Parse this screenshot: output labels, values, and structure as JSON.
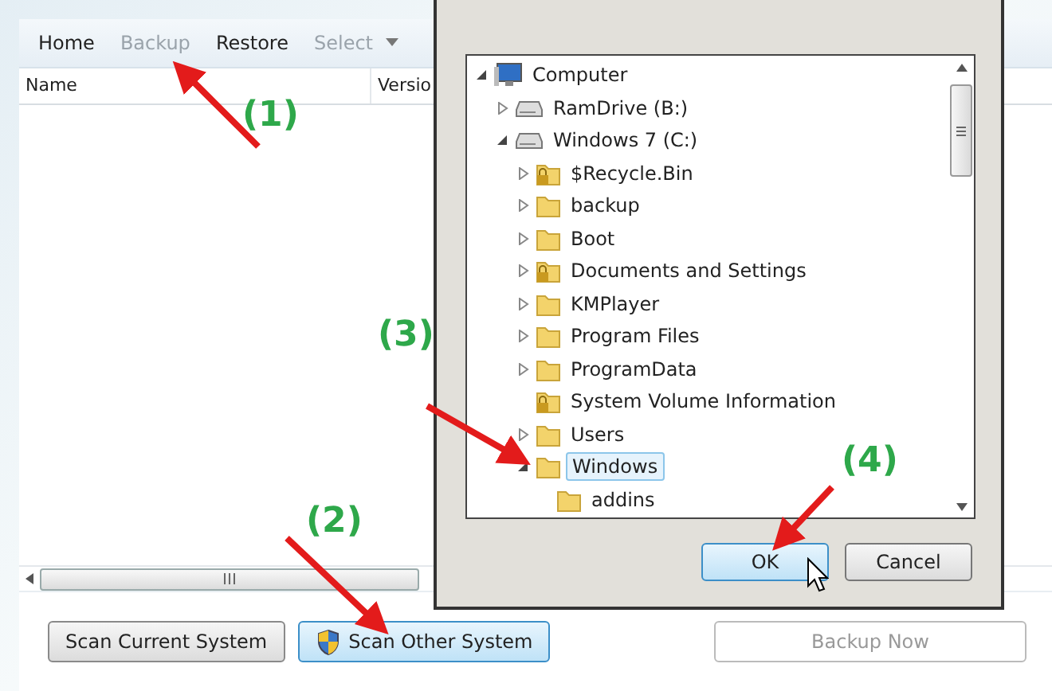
{
  "toolbar": [
    {
      "label": "Home",
      "disabled": false
    },
    {
      "label": "Backup",
      "disabled": true
    },
    {
      "label": "Restore",
      "disabled": false
    },
    {
      "label": "Select",
      "disabled": true,
      "dropdown": true
    }
  ],
  "table": {
    "columns": [
      "Name",
      "Versio"
    ]
  },
  "bottom_buttons": [
    {
      "label": "Scan Current System",
      "focused": false,
      "disabled": false,
      "shield": false
    },
    {
      "label": "Scan Other System",
      "focused": true,
      "disabled": false,
      "shield": true
    },
    {
      "label": "Backup Now",
      "focused": false,
      "disabled": true,
      "shield": false
    }
  ],
  "dialog": {
    "tree": [
      {
        "label": "Computer",
        "kind": "computer",
        "expanded": true,
        "selected": false,
        "children": [
          {
            "label": "RamDrive (B:)",
            "kind": "drive",
            "expanded": false,
            "selected": false
          },
          {
            "label": "Windows 7 (C:)",
            "kind": "drive",
            "expanded": true,
            "selected": false,
            "children": [
              {
                "label": "$Recycle.Bin",
                "kind": "locked-folder",
                "expanded": false,
                "selected": false
              },
              {
                "label": "backup",
                "kind": "folder",
                "expanded": false,
                "selected": false
              },
              {
                "label": "Boot",
                "kind": "folder",
                "expanded": false,
                "selected": false
              },
              {
                "label": "Documents and Settings",
                "kind": "locked-folder",
                "expanded": false,
                "selected": false
              },
              {
                "label": "KMPlayer",
                "kind": "folder",
                "expanded": false,
                "selected": false
              },
              {
                "label": "Program Files",
                "kind": "folder",
                "expanded": false,
                "selected": false
              },
              {
                "label": "ProgramData",
                "kind": "folder",
                "expanded": false,
                "selected": false
              },
              {
                "label": "System Volume Information",
                "kind": "locked-folder",
                "selected": false
              },
              {
                "label": "Users",
                "kind": "folder",
                "expanded": false,
                "selected": false
              },
              {
                "label": "Windows",
                "kind": "folder",
                "expanded": true,
                "selected": true,
                "children": [
                  {
                    "label": "addins",
                    "kind": "folder",
                    "selected": false
                  }
                ]
              }
            ]
          }
        ]
      }
    ],
    "buttons": [
      {
        "label": "OK",
        "focused": true
      },
      {
        "label": "Cancel",
        "focused": false
      }
    ]
  },
  "annotations": [
    "(1)",
    "(2)",
    "(3)",
    "(4)"
  ]
}
